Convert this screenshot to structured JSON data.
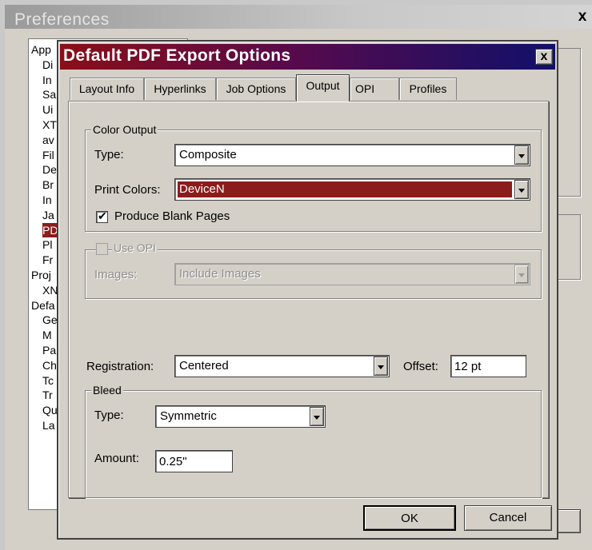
{
  "preferences": {
    "title": "Preferences",
    "close_glyph": "x",
    "list_items": [
      "App",
      "Di",
      "In",
      "Sa",
      "Ui",
      "XT",
      "av",
      "Fil",
      "De",
      "Br",
      "In",
      "Ja",
      "PD",
      "Pl",
      "Fr",
      "Proj",
      "XN",
      "Defa",
      "Ge",
      "M",
      "Pa",
      "Ch",
      "Tc",
      "Tr",
      "Qu",
      "La"
    ],
    "selected_item": "PD"
  },
  "dialog": {
    "title": "Default PDF Export Options",
    "close_glyph": "x",
    "title_colors": [
      "#8a0f18",
      "#10106a"
    ],
    "tabs": [
      {
        "label": "Layout Info",
        "active": false
      },
      {
        "label": "Hyperlinks",
        "active": false
      },
      {
        "label": "Job Options",
        "active": false
      },
      {
        "label": "Output",
        "active": true
      },
      {
        "label": "OPI",
        "active": false
      },
      {
        "label": "Profiles",
        "active": false
      }
    ],
    "color_output": {
      "legend": "Color Output",
      "type_label": "Type:",
      "type_value": "Composite",
      "print_colors_label": "Print Colors:",
      "print_colors_value": "DeviceN",
      "produce_blank_pages_label": "Produce Blank Pages",
      "produce_blank_pages_checked": true
    },
    "opi": {
      "use_opi_label": "Use OPI",
      "use_opi_checked": false,
      "images_label": "Images:",
      "images_value": "Include Images"
    },
    "registration_label": "Registration:",
    "registration_value": "Centered",
    "offset_label": "Offset:",
    "offset_value": "12 pt",
    "bleed": {
      "legend": "Bleed",
      "type_label": "Type:",
      "type_value": "Symmetric",
      "amount_label": "Amount:",
      "amount_value": "0.25\""
    },
    "ok_label": "OK",
    "cancel_label": "Cancel"
  }
}
